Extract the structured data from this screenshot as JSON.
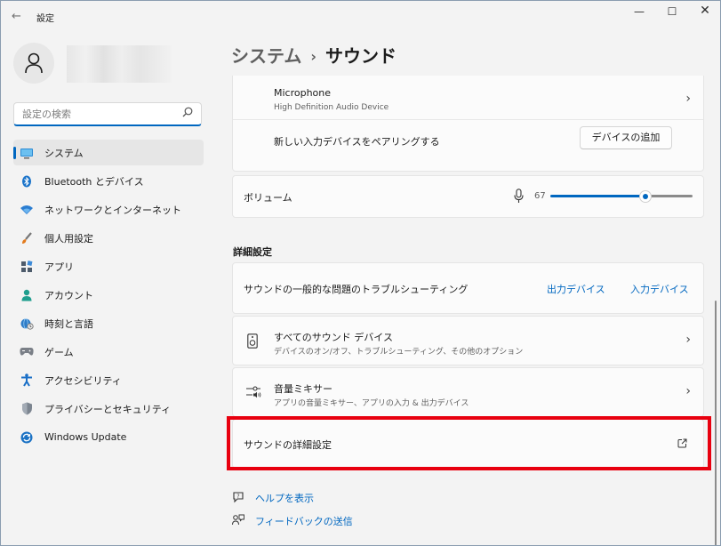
{
  "window": {
    "title": "設定"
  },
  "user": {
    "name": ""
  },
  "search": {
    "placeholder": "設定の検索"
  },
  "sidebar": {
    "items": [
      {
        "label": "システム",
        "icon": "monitor-icon",
        "active": true
      },
      {
        "label": "Bluetooth とデバイス",
        "icon": "bluetooth-icon"
      },
      {
        "label": "ネットワークとインターネット",
        "icon": "wifi-icon"
      },
      {
        "label": "個人用設定",
        "icon": "brush-icon"
      },
      {
        "label": "アプリ",
        "icon": "apps-icon"
      },
      {
        "label": "アカウント",
        "icon": "person-icon"
      },
      {
        "label": "時刻と言語",
        "icon": "globe-clock-icon"
      },
      {
        "label": "ゲーム",
        "icon": "gamepad-icon"
      },
      {
        "label": "アクセシビリティ",
        "icon": "accessibility-icon"
      },
      {
        "label": "プライバシーとセキュリティ",
        "icon": "shield-icon"
      },
      {
        "label": "Windows Update",
        "icon": "update-icon"
      }
    ]
  },
  "breadcrumb": {
    "parent": "システム",
    "separator": "›",
    "current": "サウンド"
  },
  "input": {
    "microphone_title": "Microphone",
    "microphone_subtitle": "High Definition Audio Device",
    "pair_label": "新しい入力デバイスをペアリングする",
    "add_device_button": "デバイスの追加"
  },
  "volume": {
    "label": "ボリューム",
    "value": "67",
    "level": 67
  },
  "advanced": {
    "section_label": "詳細設定",
    "troubleshoot_label": "サウンドの一般的な問題のトラブルシューティング",
    "output_link": "出力デバイス",
    "input_link": "入力デバイス",
    "all_devices_title": "すべてのサウンド デバイス",
    "all_devices_subtitle": "デバイスのオン/オフ、トラブルシューティング、その他のオプション",
    "mixer_title": "音量ミキサー",
    "mixer_subtitle": "アプリの音量ミキサー、アプリの入力 & 出力デバイス",
    "more_settings_label": "サウンドの詳細設定"
  },
  "footer": {
    "help_link": "ヘルプを表示",
    "feedback_link": "フィードバックの送信"
  },
  "colors": {
    "accent": "#0067c0",
    "highlight": "#e8000f"
  }
}
